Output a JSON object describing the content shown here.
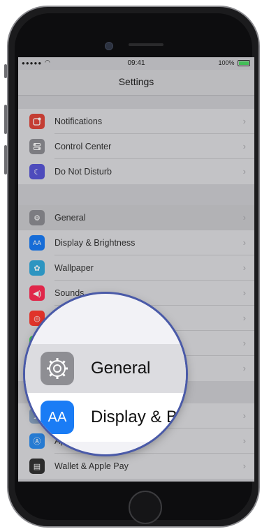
{
  "status_bar": {
    "signal": "●●●●● ",
    "time": "09:41",
    "battery": "100%"
  },
  "nav": {
    "title": "Settings"
  },
  "groups": [
    {
      "items": [
        {
          "label": "Notifications",
          "icon": "notifications-icon",
          "color": "#e0463b"
        },
        {
          "label": "Control Center",
          "icon": "control-center-icon",
          "color": "#8e8e93"
        },
        {
          "label": "Do Not Disturb",
          "icon": "moon-icon",
          "color": "#5856d6"
        }
      ]
    },
    {
      "items": [
        {
          "label": "General",
          "icon": "gear-icon",
          "color": "#8e8e93"
        },
        {
          "label": "Display & Brightness",
          "icon": "display-brightness-icon",
          "color": "#1a7cf5"
        },
        {
          "label": "Wallpaper",
          "icon": "wallpaper-icon",
          "color": "#34aadc"
        },
        {
          "label": "Sounds",
          "icon": "speaker-icon",
          "color": "#ff2d55"
        },
        {
          "label": "",
          "icon": "touch-id-icon",
          "color": "#ff3b30"
        },
        {
          "label": "",
          "icon": "battery-icon",
          "color": "#4cd964"
        },
        {
          "label": "",
          "icon": "privacy-icon",
          "color": "#8e8e93"
        }
      ]
    },
    {
      "items": [
        {
          "label": "",
          "icon": "icloud-icon",
          "color": "#8ea8c8"
        },
        {
          "label": "Ap",
          "icon": "app-store-icon",
          "color": "#2d8cf0"
        },
        {
          "label": "Wallet & Apple Pay",
          "icon": "wallet-icon",
          "color": "#333333"
        }
      ]
    }
  ],
  "magnifier": {
    "general_label": "General",
    "display_label": "Display & B",
    "display_icon_text": "AA"
  },
  "colors": {
    "accent": "#1a7cf5",
    "magnifier_ring": "#4a5aa8"
  }
}
